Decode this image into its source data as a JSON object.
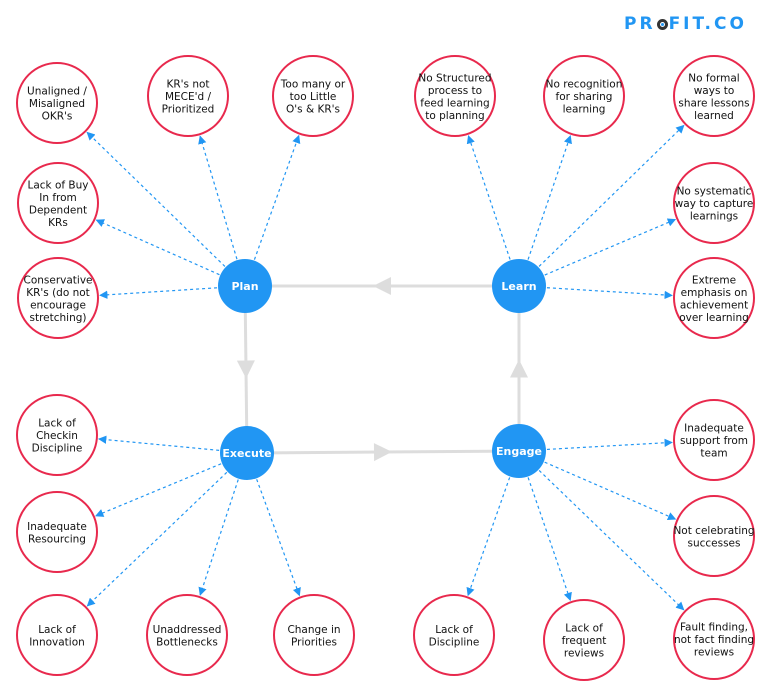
{
  "brand": {
    "logo_text_before": "PR",
    "logo_text_after": "FIT.CO",
    "accent_color": "#2196f3",
    "issue_border_color": "#e8294d",
    "flow_line_color": "#dddddd"
  },
  "stages": [
    {
      "id": "plan",
      "label": "Plan"
    },
    {
      "id": "learn",
      "label": "Learn"
    },
    {
      "id": "execute",
      "label": "Execute"
    },
    {
      "id": "engage",
      "label": "Engage"
    }
  ],
  "cycle": [
    "plan",
    "execute",
    "engage",
    "learn",
    "plan"
  ],
  "issues": {
    "plan": [
      {
        "lines": [
          "Unaligned /",
          "Misaligned",
          "OKR's"
        ]
      },
      {
        "lines": [
          "KR's not",
          "MECE'd /",
          "Prioritized"
        ]
      },
      {
        "lines": [
          "Too many or",
          "too Little",
          "O's & KR's"
        ]
      },
      {
        "lines": [
          "Lack of Buy",
          "In from",
          "Dependent",
          "KRs"
        ]
      },
      {
        "lines": [
          "Conservative",
          "KR's (do not",
          "encourage",
          "stretching)"
        ]
      }
    ],
    "learn": [
      {
        "lines": [
          "No Structured",
          "process to",
          "feed learning",
          "to planning"
        ]
      },
      {
        "lines": [
          "No recognition",
          "for sharing",
          "learning"
        ]
      },
      {
        "lines": [
          "No formal",
          "ways to",
          "share lessons",
          "learned"
        ]
      },
      {
        "lines": [
          "No systematic",
          "way to capture",
          "learnings"
        ]
      },
      {
        "lines": [
          "Extreme",
          "emphasis on",
          "achievement",
          "over learning"
        ]
      }
    ],
    "execute": [
      {
        "lines": [
          "Lack of",
          "Checkin",
          "Discipline"
        ]
      },
      {
        "lines": [
          "Inadequate",
          "Resourcing"
        ]
      },
      {
        "lines": [
          "Lack of",
          "Innovation"
        ]
      },
      {
        "lines": [
          "Unaddressed",
          "Bottlenecks"
        ]
      },
      {
        "lines": [
          "Change in",
          "Priorities"
        ]
      }
    ],
    "engage": [
      {
        "lines": [
          "Inadequate",
          "support from",
          "team"
        ]
      },
      {
        "lines": [
          "Not celebrating",
          "successes"
        ]
      },
      {
        "lines": [
          "Lack of",
          "Discipline"
        ]
      },
      {
        "lines": [
          "Lack of",
          "frequent",
          "reviews"
        ]
      },
      {
        "lines": [
          "Fault finding,",
          "not fact finding",
          "reviews"
        ]
      }
    ]
  }
}
